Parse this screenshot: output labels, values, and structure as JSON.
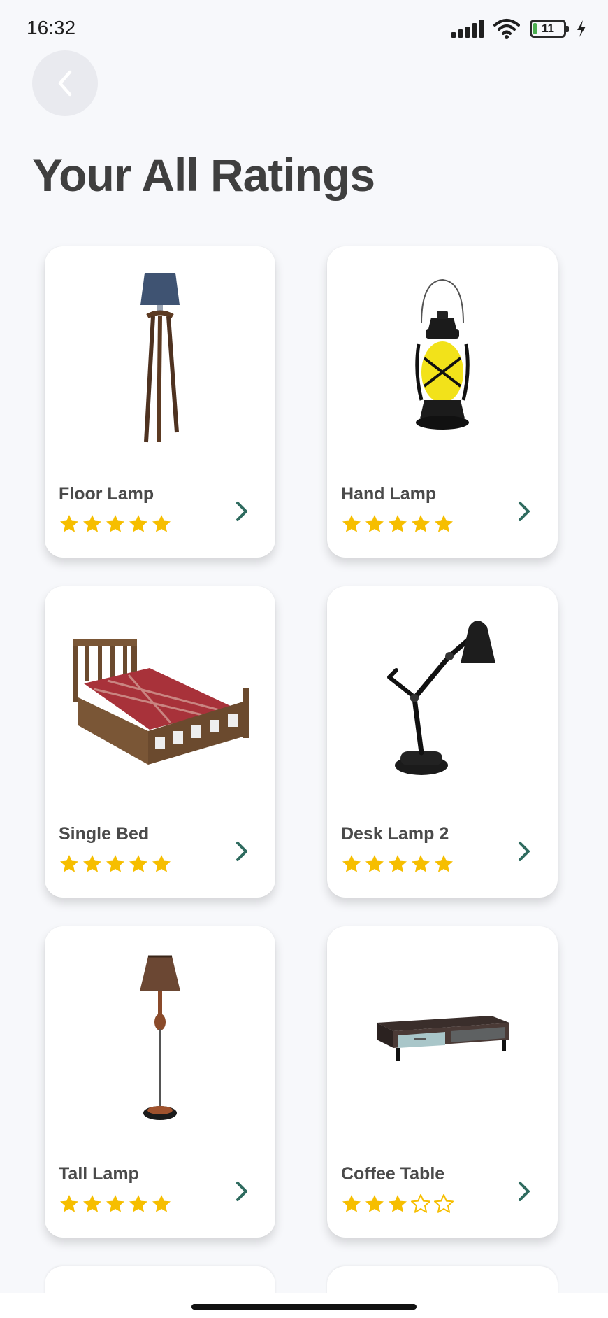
{
  "status_bar": {
    "time": "16:32",
    "battery_level": "11",
    "battery_fraction": 0.11
  },
  "page": {
    "title": "Your All Ratings"
  },
  "colors": {
    "accent": "#2f6b5f",
    "star": "#f6be00",
    "background": "#f7f8fb"
  },
  "products": [
    {
      "name": "Floor Lamp",
      "rating": 5,
      "max_rating": 5,
      "image": "floor-lamp-image"
    },
    {
      "name": "Hand Lamp",
      "rating": 5,
      "max_rating": 5,
      "image": "hand-lamp-image"
    },
    {
      "name": "Single Bed",
      "rating": 5,
      "max_rating": 5,
      "image": "single-bed-image"
    },
    {
      "name": "Desk Lamp 2",
      "rating": 5,
      "max_rating": 5,
      "image": "desk-lamp-image"
    },
    {
      "name": "Tall Lamp",
      "rating": 5,
      "max_rating": 5,
      "image": "tall-lamp-image"
    },
    {
      "name": "Coffee Table",
      "rating": 3,
      "max_rating": 5,
      "image": "coffee-table-image"
    }
  ]
}
